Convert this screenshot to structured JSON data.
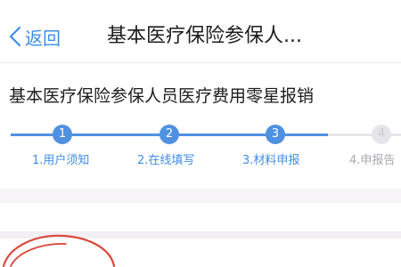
{
  "navbar": {
    "back_label": "返回",
    "title": "基本医疗保险参保人..."
  },
  "form": {
    "heading": "基本医疗保险参保人员医疗费用零星报销"
  },
  "progress": {
    "current_step": 3,
    "steps": [
      {
        "number": "1",
        "label": "1.用户须知",
        "state": "done"
      },
      {
        "number": "2",
        "label": "2.在线填写",
        "state": "done"
      },
      {
        "number": "3",
        "label": "3.材料申报",
        "state": "current"
      },
      {
        "number": "4",
        "label": "4.申报告",
        "state": "pending"
      }
    ]
  },
  "colors": {
    "accent": "#3e8ee8",
    "step_active": "#4f91e0",
    "step_inactive": "#e6e6ea",
    "annotation": "#d94a3c"
  }
}
